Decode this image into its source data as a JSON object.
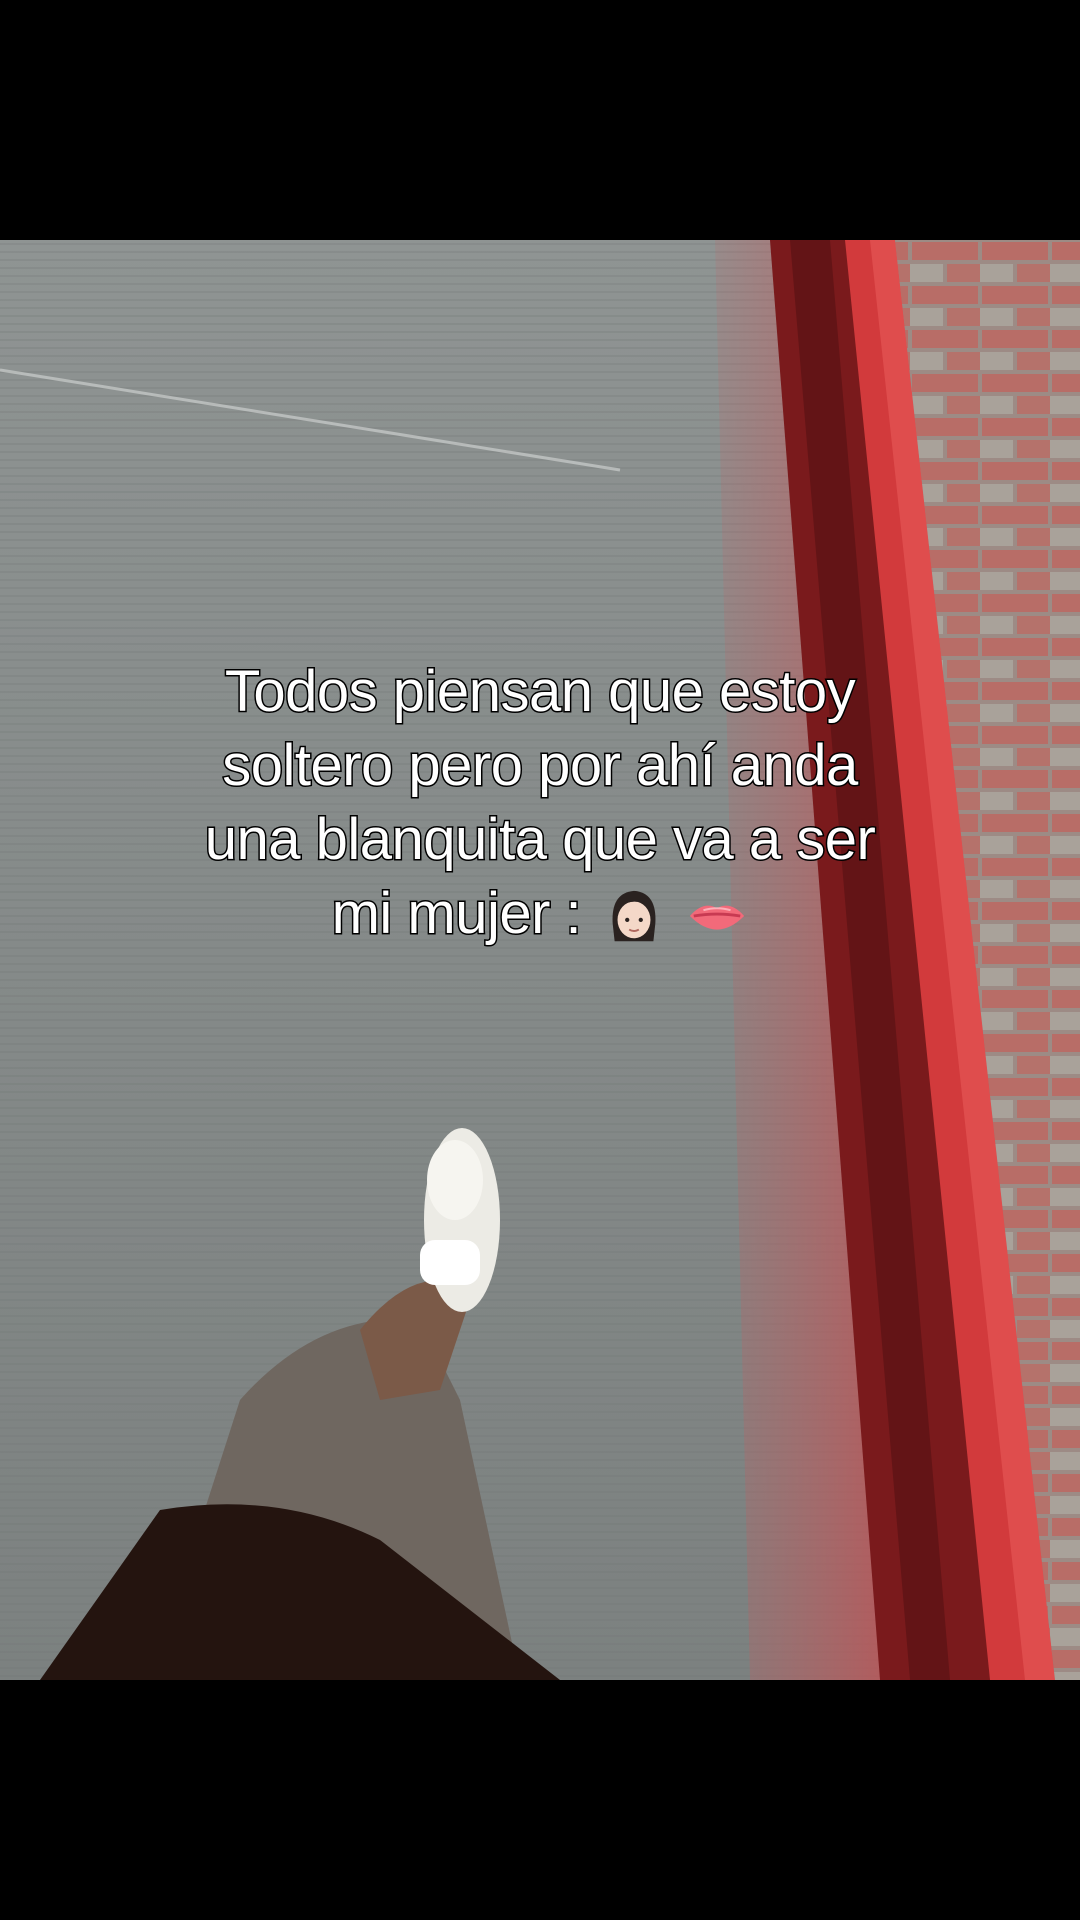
{
  "caption": {
    "line1": "Todos piensan que estoy",
    "line2": "soltero pero por ahí anda",
    "line3": "una blanquita que va a ser",
    "line4": "mi mujer :"
  },
  "emojis": [
    "woman-face-icon",
    "lips-icon"
  ],
  "colors": {
    "letterbox": "#000000",
    "pavement": "#8a8e8d",
    "curb_red": "#c8373a",
    "brick": "#b86d67",
    "text": "#ffffff",
    "text_outline": "#000000"
  }
}
